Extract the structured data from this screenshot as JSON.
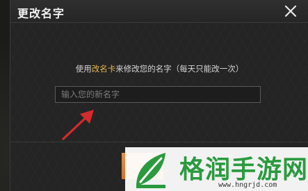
{
  "dialog": {
    "title": "更改名字",
    "instruction_prefix": "使用",
    "instruction_highlight": "改名卡",
    "instruction_suffix": "来修改您的名字（每天只能改一次）",
    "input": {
      "value": "",
      "placeholder": "输入您的新名字"
    }
  },
  "colors": {
    "highlight": "#e2b84a",
    "arrow": "#d62b2b",
    "confirm_button": "#e0823a"
  },
  "icons": {
    "close": "close-icon",
    "arrow": "red-arrow-annotation"
  },
  "watermark": {
    "text": "格润手游网",
    "url": "www.hngrjd.com"
  }
}
